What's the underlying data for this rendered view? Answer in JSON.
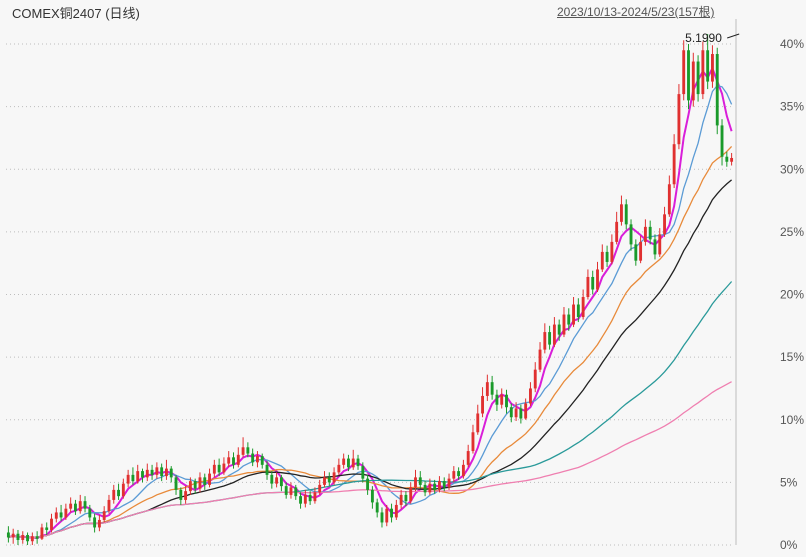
{
  "header": {
    "title": "COMEX铜2407 (日线)",
    "range": "2023/10/13-2024/5/23(157根)"
  },
  "chart_data": {
    "type": "candlestick",
    "y_axis": {
      "ticks": [
        "0%",
        "5%",
        "10%",
        "15%",
        "20%",
        "25%",
        "30%",
        "35%",
        "40%"
      ],
      "ylim": [
        0,
        42
      ],
      "position": "right"
    },
    "annotations": [
      {
        "text": "5.1990",
        "x_index": 153,
        "y": 40.8
      }
    ],
    "grid": true,
    "bar_count": 157,
    "candles": [
      {
        "o": 1.0,
        "c": 0.6,
        "h": 1.5,
        "l": 0.2
      },
      {
        "o": 0.6,
        "c": 0.9,
        "h": 1.3,
        "l": 0.1
      },
      {
        "o": 0.9,
        "c": 0.4,
        "h": 1.2,
        "l": 0.0
      },
      {
        "o": 0.4,
        "c": 0.8,
        "h": 1.1,
        "l": 0.1
      },
      {
        "o": 0.8,
        "c": 0.3,
        "h": 1.0,
        "l": 0.0
      },
      {
        "o": 0.3,
        "c": 0.7,
        "h": 1.0,
        "l": 0.0
      },
      {
        "o": 0.7,
        "c": 0.5,
        "h": 1.1,
        "l": 0.1
      },
      {
        "o": 0.5,
        "c": 1.4,
        "h": 1.7,
        "l": 0.4
      },
      {
        "o": 1.4,
        "c": 1.2,
        "h": 1.8,
        "l": 0.8
      },
      {
        "o": 1.2,
        "c": 2.1,
        "h": 2.5,
        "l": 1.0
      },
      {
        "o": 2.1,
        "c": 2.6,
        "h": 3.0,
        "l": 1.8
      },
      {
        "o": 2.6,
        "c": 2.2,
        "h": 3.2,
        "l": 1.9
      },
      {
        "o": 2.2,
        "c": 2.9,
        "h": 3.3,
        "l": 2.0
      },
      {
        "o": 2.9,
        "c": 3.3,
        "h": 3.8,
        "l": 2.6
      },
      {
        "o": 3.3,
        "c": 2.7,
        "h": 3.6,
        "l": 2.4
      },
      {
        "o": 2.7,
        "c": 3.5,
        "h": 4.0,
        "l": 2.5
      },
      {
        "o": 3.5,
        "c": 2.9,
        "h": 3.9,
        "l": 2.6
      },
      {
        "o": 2.9,
        "c": 2.2,
        "h": 3.2,
        "l": 1.9
      },
      {
        "o": 2.2,
        "c": 1.4,
        "h": 2.5,
        "l": 1.0
      },
      {
        "o": 1.4,
        "c": 2.0,
        "h": 2.4,
        "l": 1.1
      },
      {
        "o": 2.0,
        "c": 2.7,
        "h": 3.1,
        "l": 1.8
      },
      {
        "o": 2.7,
        "c": 3.6,
        "h": 4.0,
        "l": 2.5
      },
      {
        "o": 3.6,
        "c": 4.4,
        "h": 4.8,
        "l": 3.3
      },
      {
        "o": 4.4,
        "c": 3.9,
        "h": 4.9,
        "l": 3.6
      },
      {
        "o": 3.9,
        "c": 4.9,
        "h": 5.3,
        "l": 3.7
      },
      {
        "o": 4.9,
        "c": 5.6,
        "h": 6.0,
        "l": 4.6
      },
      {
        "o": 5.6,
        "c": 5.1,
        "h": 6.2,
        "l": 4.8
      },
      {
        "o": 5.1,
        "c": 5.9,
        "h": 6.4,
        "l": 4.9
      },
      {
        "o": 5.9,
        "c": 5.4,
        "h": 6.1,
        "l": 5.0
      },
      {
        "o": 5.4,
        "c": 6.0,
        "h": 6.5,
        "l": 5.1
      },
      {
        "o": 6.0,
        "c": 5.6,
        "h": 6.4,
        "l": 5.2
      },
      {
        "o": 5.6,
        "c": 6.2,
        "h": 6.6,
        "l": 5.3
      },
      {
        "o": 6.2,
        "c": 5.5,
        "h": 6.5,
        "l": 5.1
      },
      {
        "o": 5.5,
        "c": 6.1,
        "h": 6.8,
        "l": 5.2
      },
      {
        "o": 6.1,
        "c": 5.4,
        "h": 6.3,
        "l": 5.0
      },
      {
        "o": 5.4,
        "c": 4.4,
        "h": 5.6,
        "l": 4.0
      },
      {
        "o": 4.4,
        "c": 3.6,
        "h": 4.6,
        "l": 3.2
      },
      {
        "o": 3.6,
        "c": 4.3,
        "h": 4.7,
        "l": 3.3
      },
      {
        "o": 4.3,
        "c": 5.1,
        "h": 5.4,
        "l": 4.0
      },
      {
        "o": 5.1,
        "c": 4.5,
        "h": 5.3,
        "l": 4.1
      },
      {
        "o": 4.5,
        "c": 5.4,
        "h": 5.8,
        "l": 4.2
      },
      {
        "o": 5.4,
        "c": 4.8,
        "h": 5.7,
        "l": 4.4
      },
      {
        "o": 4.8,
        "c": 5.7,
        "h": 6.1,
        "l": 4.6
      },
      {
        "o": 5.7,
        "c": 6.4,
        "h": 6.8,
        "l": 5.4
      },
      {
        "o": 6.4,
        "c": 5.8,
        "h": 6.9,
        "l": 5.5
      },
      {
        "o": 5.8,
        "c": 6.5,
        "h": 7.0,
        "l": 5.6
      },
      {
        "o": 6.5,
        "c": 7.0,
        "h": 7.5,
        "l": 6.2
      },
      {
        "o": 7.0,
        "c": 6.4,
        "h": 7.4,
        "l": 6.1
      },
      {
        "o": 6.4,
        "c": 7.2,
        "h": 7.8,
        "l": 6.2
      },
      {
        "o": 7.2,
        "c": 7.8,
        "h": 8.6,
        "l": 7.0
      },
      {
        "o": 7.8,
        "c": 7.3,
        "h": 8.2,
        "l": 7.0
      },
      {
        "o": 7.3,
        "c": 6.6,
        "h": 7.7,
        "l": 6.3
      },
      {
        "o": 6.6,
        "c": 7.1,
        "h": 7.5,
        "l": 6.2
      },
      {
        "o": 7.1,
        "c": 6.4,
        "h": 7.3,
        "l": 6.1
      },
      {
        "o": 6.4,
        "c": 5.6,
        "h": 6.7,
        "l": 5.2
      },
      {
        "o": 5.6,
        "c": 4.9,
        "h": 5.9,
        "l": 4.5
      },
      {
        "o": 4.9,
        "c": 5.4,
        "h": 5.8,
        "l": 4.6
      },
      {
        "o": 5.4,
        "c": 4.7,
        "h": 5.6,
        "l": 4.3
      },
      {
        "o": 4.7,
        "c": 4.0,
        "h": 5.0,
        "l": 3.7
      },
      {
        "o": 4.0,
        "c": 4.6,
        "h": 5.0,
        "l": 3.7
      },
      {
        "o": 4.6,
        "c": 3.9,
        "h": 4.8,
        "l": 3.6
      },
      {
        "o": 3.9,
        "c": 3.3,
        "h": 4.2,
        "l": 2.9
      },
      {
        "o": 3.3,
        "c": 4.0,
        "h": 4.4,
        "l": 3.0
      },
      {
        "o": 4.0,
        "c": 3.5,
        "h": 4.3,
        "l": 3.2
      },
      {
        "o": 3.5,
        "c": 4.2,
        "h": 4.6,
        "l": 3.3
      },
      {
        "o": 4.2,
        "c": 4.8,
        "h": 5.2,
        "l": 4.0
      },
      {
        "o": 4.8,
        "c": 5.4,
        "h": 5.9,
        "l": 4.6
      },
      {
        "o": 5.4,
        "c": 5.0,
        "h": 5.8,
        "l": 4.7
      },
      {
        "o": 5.0,
        "c": 5.8,
        "h": 6.2,
        "l": 4.8
      },
      {
        "o": 5.8,
        "c": 6.4,
        "h": 6.9,
        "l": 5.6
      },
      {
        "o": 6.4,
        "c": 6.9,
        "h": 7.3,
        "l": 6.1
      },
      {
        "o": 6.9,
        "c": 6.2,
        "h": 7.2,
        "l": 5.9
      },
      {
        "o": 6.2,
        "c": 6.9,
        "h": 7.6,
        "l": 6.0
      },
      {
        "o": 6.9,
        "c": 6.3,
        "h": 7.2,
        "l": 6.0
      },
      {
        "o": 6.3,
        "c": 5.3,
        "h": 6.6,
        "l": 5.0
      },
      {
        "o": 5.3,
        "c": 4.4,
        "h": 5.6,
        "l": 4.0
      },
      {
        "o": 4.4,
        "c": 3.4,
        "h": 4.7,
        "l": 2.9
      },
      {
        "o": 3.4,
        "c": 2.6,
        "h": 3.7,
        "l": 2.2
      },
      {
        "o": 2.6,
        "c": 1.8,
        "h": 3.0,
        "l": 1.4
      },
      {
        "o": 1.8,
        "c": 2.9,
        "h": 3.2,
        "l": 1.5
      },
      {
        "o": 2.9,
        "c": 2.2,
        "h": 3.3,
        "l": 1.8
      },
      {
        "o": 2.2,
        "c": 3.2,
        "h": 3.6,
        "l": 2.0
      },
      {
        "o": 3.2,
        "c": 4.0,
        "h": 4.4,
        "l": 2.9
      },
      {
        "o": 4.0,
        "c": 3.5,
        "h": 4.3,
        "l": 3.1
      },
      {
        "o": 3.5,
        "c": 4.6,
        "h": 5.0,
        "l": 3.3
      },
      {
        "o": 4.6,
        "c": 5.4,
        "h": 6.0,
        "l": 4.3
      },
      {
        "o": 5.4,
        "c": 4.8,
        "h": 5.9,
        "l": 4.5
      },
      {
        "o": 4.8,
        "c": 4.2,
        "h": 5.1,
        "l": 3.9
      },
      {
        "o": 4.2,
        "c": 4.9,
        "h": 5.3,
        "l": 4.0
      },
      {
        "o": 4.9,
        "c": 4.4,
        "h": 5.2,
        "l": 4.1
      },
      {
        "o": 4.4,
        "c": 5.1,
        "h": 5.5,
        "l": 4.2
      },
      {
        "o": 5.1,
        "c": 4.6,
        "h": 5.4,
        "l": 4.3
      },
      {
        "o": 4.6,
        "c": 5.3,
        "h": 5.7,
        "l": 4.4
      },
      {
        "o": 5.3,
        "c": 5.9,
        "h": 6.3,
        "l": 5.0
      },
      {
        "o": 5.9,
        "c": 5.5,
        "h": 6.2,
        "l": 5.2
      },
      {
        "o": 5.5,
        "c": 6.4,
        "h": 6.8,
        "l": 5.3
      },
      {
        "o": 6.4,
        "c": 7.5,
        "h": 8.0,
        "l": 6.2
      },
      {
        "o": 7.5,
        "c": 9.0,
        "h": 9.6,
        "l": 7.3
      },
      {
        "o": 9.0,
        "c": 10.5,
        "h": 11.2,
        "l": 8.8
      },
      {
        "o": 10.5,
        "c": 11.9,
        "h": 12.6,
        "l": 10.2
      },
      {
        "o": 11.9,
        "c": 13.0,
        "h": 13.6,
        "l": 11.5
      },
      {
        "o": 13.0,
        "c": 12.0,
        "h": 13.5,
        "l": 11.6
      },
      {
        "o": 12.0,
        "c": 11.2,
        "h": 12.4,
        "l": 10.7
      },
      {
        "o": 11.2,
        "c": 12.0,
        "h": 12.5,
        "l": 10.9
      },
      {
        "o": 12.0,
        "c": 11.0,
        "h": 12.4,
        "l": 10.5
      },
      {
        "o": 11.0,
        "c": 10.2,
        "h": 11.3,
        "l": 9.8
      },
      {
        "o": 10.2,
        "c": 10.9,
        "h": 11.4,
        "l": 9.9
      },
      {
        "o": 10.9,
        "c": 10.1,
        "h": 11.2,
        "l": 9.7
      },
      {
        "o": 10.1,
        "c": 11.3,
        "h": 11.7,
        "l": 10.0
      },
      {
        "o": 11.3,
        "c": 12.5,
        "h": 13.0,
        "l": 11.1
      },
      {
        "o": 12.5,
        "c": 14.0,
        "h": 14.6,
        "l": 12.2
      },
      {
        "o": 14.0,
        "c": 15.6,
        "h": 16.2,
        "l": 13.8
      },
      {
        "o": 15.6,
        "c": 17.0,
        "h": 17.7,
        "l": 15.3
      },
      {
        "o": 17.0,
        "c": 16.0,
        "h": 17.5,
        "l": 15.6
      },
      {
        "o": 16.0,
        "c": 17.6,
        "h": 18.2,
        "l": 15.8
      },
      {
        "o": 17.6,
        "c": 16.8,
        "h": 18.0,
        "l": 16.3
      },
      {
        "o": 16.8,
        "c": 18.4,
        "h": 19.0,
        "l": 16.6
      },
      {
        "o": 18.4,
        "c": 17.6,
        "h": 18.9,
        "l": 17.1
      },
      {
        "o": 17.6,
        "c": 19.2,
        "h": 19.8,
        "l": 17.4
      },
      {
        "o": 19.2,
        "c": 18.2,
        "h": 19.7,
        "l": 17.8
      },
      {
        "o": 18.2,
        "c": 19.8,
        "h": 20.4,
        "l": 18.0
      },
      {
        "o": 19.8,
        "c": 21.4,
        "h": 22.0,
        "l": 19.6
      },
      {
        "o": 21.4,
        "c": 20.4,
        "h": 21.9,
        "l": 20.0
      },
      {
        "o": 20.4,
        "c": 22.0,
        "h": 22.6,
        "l": 20.2
      },
      {
        "o": 22.0,
        "c": 23.4,
        "h": 24.0,
        "l": 21.8
      },
      {
        "o": 23.4,
        "c": 22.6,
        "h": 23.9,
        "l": 22.2
      },
      {
        "o": 22.6,
        "c": 24.2,
        "h": 24.8,
        "l": 22.4
      },
      {
        "o": 24.2,
        "c": 25.8,
        "h": 26.6,
        "l": 24.0
      },
      {
        "o": 25.8,
        "c": 27.2,
        "h": 27.9,
        "l": 25.5
      },
      {
        "o": 27.2,
        "c": 25.6,
        "h": 27.6,
        "l": 25.2
      },
      {
        "o": 25.6,
        "c": 24.0,
        "h": 26.0,
        "l": 23.5
      },
      {
        "o": 24.0,
        "c": 22.7,
        "h": 24.4,
        "l": 22.3
      },
      {
        "o": 22.7,
        "c": 24.2,
        "h": 24.7,
        "l": 22.5
      },
      {
        "o": 24.2,
        "c": 25.4,
        "h": 26.0,
        "l": 23.9
      },
      {
        "o": 25.4,
        "c": 24.4,
        "h": 25.9,
        "l": 24.0
      },
      {
        "o": 24.4,
        "c": 23.2,
        "h": 24.8,
        "l": 22.8
      },
      {
        "o": 23.2,
        "c": 24.8,
        "h": 25.3,
        "l": 23.0
      },
      {
        "o": 24.8,
        "c": 26.4,
        "h": 27.0,
        "l": 24.6
      },
      {
        "o": 26.4,
        "c": 28.8,
        "h": 29.5,
        "l": 26.2
      },
      {
        "o": 28.8,
        "c": 32.0,
        "h": 32.8,
        "l": 28.5
      },
      {
        "o": 32.0,
        "c": 36.0,
        "h": 36.8,
        "l": 31.6
      },
      {
        "o": 36.0,
        "c": 39.5,
        "h": 40.3,
        "l": 35.5
      },
      {
        "o": 39.5,
        "c": 35.5,
        "h": 40.0,
        "l": 34.8
      },
      {
        "o": 35.5,
        "c": 38.6,
        "h": 39.3,
        "l": 35.0
      },
      {
        "o": 38.6,
        "c": 36.0,
        "h": 39.1,
        "l": 35.4
      },
      {
        "o": 36.0,
        "c": 39.5,
        "h": 40.2,
        "l": 35.6
      },
      {
        "o": 39.5,
        "c": 37.0,
        "h": 40.8,
        "l": 36.4
      },
      {
        "o": 37.0,
        "c": 39.2,
        "h": 39.9,
        "l": 36.5
      },
      {
        "o": 39.2,
        "c": 33.5,
        "h": 39.7,
        "l": 32.8
      },
      {
        "o": 33.5,
        "c": 31.0,
        "h": 34.0,
        "l": 30.3
      },
      {
        "o": 31.0,
        "c": 30.6,
        "h": 31.4,
        "l": 30.2
      },
      {
        "o": 30.6,
        "c": 30.9,
        "h": 31.3,
        "l": 30.3
      }
    ],
    "moving_averages": [
      {
        "period": 5,
        "color": "#d91ed9"
      },
      {
        "period": 10,
        "color": "#5b9bd5"
      },
      {
        "period": 20,
        "color": "#e88a3a"
      },
      {
        "period": 30,
        "color": "#222222"
      },
      {
        "period": 60,
        "color": "#2a9a9a"
      },
      {
        "period": 120,
        "color": "#ef7fb0"
      }
    ]
  },
  "colors": {
    "background": "#f7f7f7",
    "up": "#e03030",
    "down": "#1a9a2a",
    "grid": "#bdbdbd",
    "axis_text": "#555555"
  }
}
